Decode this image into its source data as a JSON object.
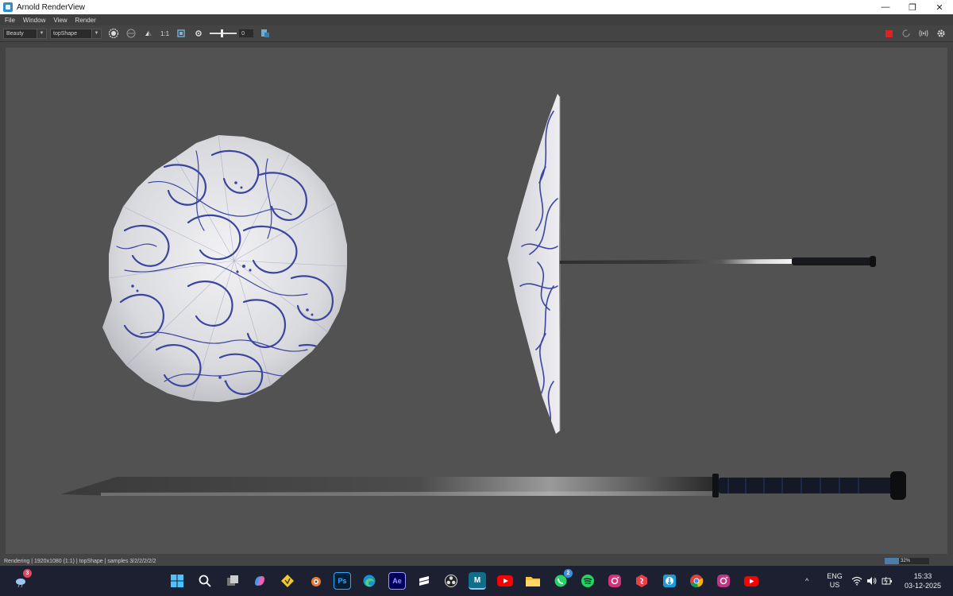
{
  "window": {
    "title": "Arnold RenderView",
    "minimize": "—",
    "maximize": "❐",
    "close": "✕"
  },
  "menu": [
    "File",
    "Window",
    "View",
    "Render"
  ],
  "toolbar": {
    "aov": "Beauty",
    "camera": "topShape",
    "ratio": "1:1",
    "exposure": "0"
  },
  "status": {
    "text": "Rendering | 1920x1080 (1:1) | topShape | samples 3/2/2/2/2/2",
    "zoom": "32%"
  },
  "taskbar": {
    "weather_badge": "3",
    "whatsapp_badge": "2",
    "photoshop": "Ps",
    "aftereffects": "Ae",
    "maya": "M",
    "lang_top": "ENG",
    "lang_bottom": "US",
    "time": "15:33",
    "date": "03-12-2025",
    "chevron": "^"
  },
  "colors": {
    "viewport": "#525252",
    "pattern_blue": "#3b45a0",
    "taskbar": "#1c2030"
  }
}
